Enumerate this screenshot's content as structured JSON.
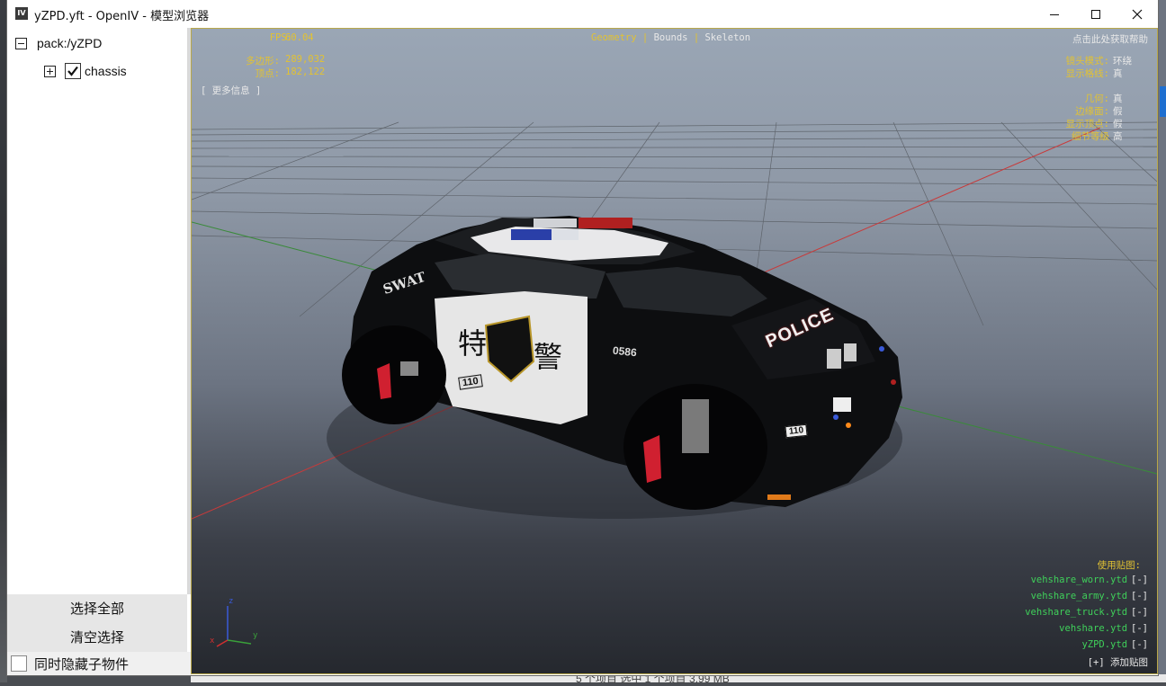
{
  "window": {
    "title": "yZPD.yft - OpenIV - 模型浏览器",
    "app_icon_text": "IV"
  },
  "tree": {
    "root_label": "pack:/yZPD",
    "child_label": "chassis",
    "child_checked": true
  },
  "buttons": {
    "select_all": "选择全部",
    "clear_selection": "清空选择",
    "hide_children": "同时隐藏子物件"
  },
  "overlay": {
    "fps_label": "FPS:",
    "fps_value": "60.04",
    "polygons_label": "多边形:",
    "polygons_value": "289,032",
    "vertices_label": "顶点:",
    "vertices_value": "182,122",
    "more_info": "[ 更多信息 ]",
    "modes": [
      "Geometry",
      "Bounds",
      "Skeleton"
    ],
    "active_mode": "Geometry",
    "help_text": "点击此处获取帮助",
    "settings": [
      {
        "label": "镜头模式:",
        "value": "环绕"
      },
      {
        "label": "显示格线:",
        "value": "真"
      },
      {
        "label": "几何:",
        "value": "真"
      },
      {
        "label": "边缘面:",
        "value": "假"
      },
      {
        "label": "显示顶点:",
        "value": "假"
      },
      {
        "label": "细节等级",
        "value": "高"
      }
    ],
    "textures_label": "使用贴图:",
    "textures": [
      "vehshare_worn.ytd",
      "vehshare_army.ytd",
      "vehshare_truck.ytd",
      "vehshare.ytd",
      "yZPD.ytd"
    ],
    "remove_label": "[-]",
    "add_texture": "[+] 添加贴图",
    "axis_labels": {
      "x": "x",
      "y": "y",
      "z": "z"
    }
  },
  "car": {
    "side_text": "SWAT",
    "hood_text": "POLICE",
    "door_char_1": "特",
    "door_char_2": "警",
    "number": "0586",
    "plate": "110"
  },
  "desktop": {
    "status_text": "5 个项目   选中 1 个项目  3.99 MB"
  },
  "colors": {
    "overlay_yellow": "#e2c233",
    "texture_green": "#3fd05a"
  }
}
